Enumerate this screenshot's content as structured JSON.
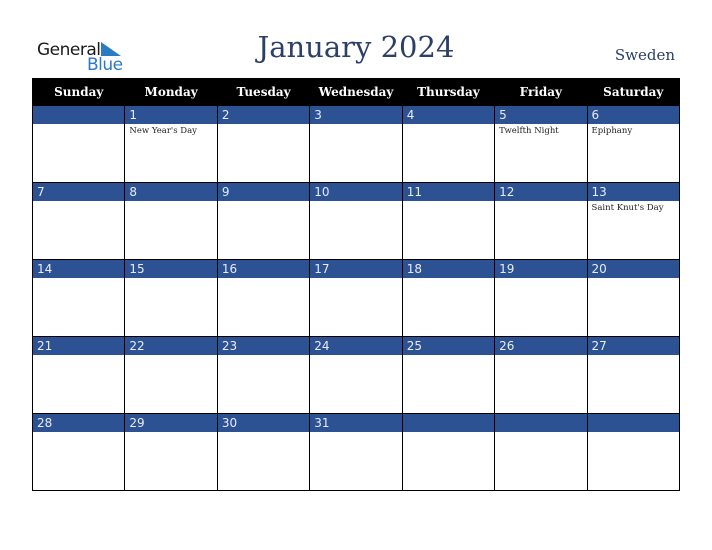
{
  "logo": {
    "general": "General",
    "blue": "Blue"
  },
  "title": "January 2024",
  "country": "Sweden",
  "colors": {
    "header_bg": "#000000",
    "day_bar": "#2d5294",
    "title": "#2c3f66",
    "logo_blue": "#2b7ac4"
  },
  "weekdays": [
    "Sunday",
    "Monday",
    "Tuesday",
    "Wednesday",
    "Thursday",
    "Friday",
    "Saturday"
  ],
  "weeks": [
    [
      {
        "day": "",
        "holiday": ""
      },
      {
        "day": "1",
        "holiday": "New Year's Day"
      },
      {
        "day": "2",
        "holiday": ""
      },
      {
        "day": "3",
        "holiday": ""
      },
      {
        "day": "4",
        "holiday": ""
      },
      {
        "day": "5",
        "holiday": "Twelfth Night"
      },
      {
        "day": "6",
        "holiday": "Epiphany"
      }
    ],
    [
      {
        "day": "7",
        "holiday": ""
      },
      {
        "day": "8",
        "holiday": ""
      },
      {
        "day": "9",
        "holiday": ""
      },
      {
        "day": "10",
        "holiday": ""
      },
      {
        "day": "11",
        "holiday": ""
      },
      {
        "day": "12",
        "holiday": ""
      },
      {
        "day": "13",
        "holiday": "Saint Knut's Day"
      }
    ],
    [
      {
        "day": "14",
        "holiday": ""
      },
      {
        "day": "15",
        "holiday": ""
      },
      {
        "day": "16",
        "holiday": ""
      },
      {
        "day": "17",
        "holiday": ""
      },
      {
        "day": "18",
        "holiday": ""
      },
      {
        "day": "19",
        "holiday": ""
      },
      {
        "day": "20",
        "holiday": ""
      }
    ],
    [
      {
        "day": "21",
        "holiday": ""
      },
      {
        "day": "22",
        "holiday": ""
      },
      {
        "day": "23",
        "holiday": ""
      },
      {
        "day": "24",
        "holiday": ""
      },
      {
        "day": "25",
        "holiday": ""
      },
      {
        "day": "26",
        "holiday": ""
      },
      {
        "day": "27",
        "holiday": ""
      }
    ],
    [
      {
        "day": "28",
        "holiday": ""
      },
      {
        "day": "29",
        "holiday": ""
      },
      {
        "day": "30",
        "holiday": ""
      },
      {
        "day": "31",
        "holiday": ""
      },
      {
        "day": "",
        "holiday": ""
      },
      {
        "day": "",
        "holiday": ""
      },
      {
        "day": "",
        "holiday": ""
      }
    ]
  ]
}
